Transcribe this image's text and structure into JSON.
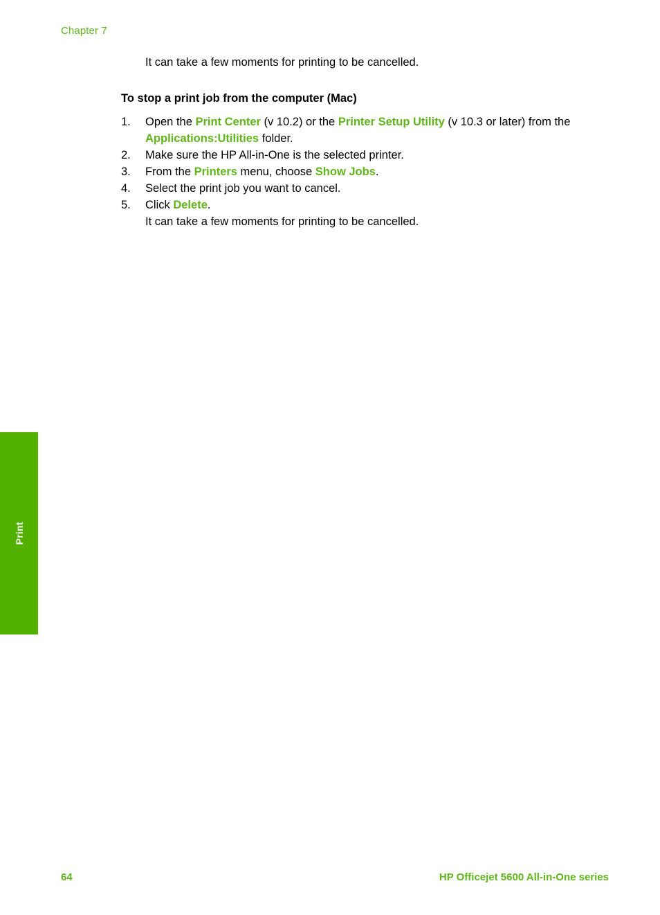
{
  "header": {
    "chapter_label": "Chapter 7"
  },
  "side_tab": {
    "label": "Print",
    "background_color": "#51B000",
    "text_color": "#FFFFFF"
  },
  "content": {
    "intro_note": "It can take a few moments for printing to be cancelled.",
    "section_heading": "To stop a print job from the computer (Mac)",
    "steps": [
      {
        "number": "1.",
        "parts": [
          {
            "text": "Open the ",
            "emphasis": false
          },
          {
            "text": "Print Center",
            "emphasis": true
          },
          {
            "text": " (v 10.2) or the ",
            "emphasis": false
          },
          {
            "text": "Printer Setup Utility",
            "emphasis": true
          },
          {
            "text": " (v 10.3 or later) from the ",
            "emphasis": false
          },
          {
            "text": "Applications:Utilities",
            "emphasis": true
          },
          {
            "text": " folder.",
            "emphasis": false
          }
        ]
      },
      {
        "number": "2.",
        "parts": [
          {
            "text": "Make sure the HP All-in-One is the selected printer.",
            "emphasis": false
          }
        ]
      },
      {
        "number": "3.",
        "parts": [
          {
            "text": "From the ",
            "emphasis": false
          },
          {
            "text": "Printers",
            "emphasis": true
          },
          {
            "text": " menu, choose ",
            "emphasis": false
          },
          {
            "text": "Show Jobs",
            "emphasis": true
          },
          {
            "text": ".",
            "emphasis": false
          }
        ]
      },
      {
        "number": "4.",
        "parts": [
          {
            "text": "Select the print job you want to cancel.",
            "emphasis": false
          }
        ]
      },
      {
        "number": "5.",
        "parts": [
          {
            "text": "Click ",
            "emphasis": false
          },
          {
            "text": "Delete",
            "emphasis": true
          },
          {
            "text": ".",
            "emphasis": false
          }
        ]
      }
    ],
    "trailing_note": "It can take a few moments for printing to be cancelled."
  },
  "footer": {
    "page_number": "64",
    "product_name": "HP Officejet 5600 All-in-One series"
  },
  "colors": {
    "accent_green": "#5FB51A",
    "tab_green": "#51B000",
    "body_text": "#000000"
  }
}
